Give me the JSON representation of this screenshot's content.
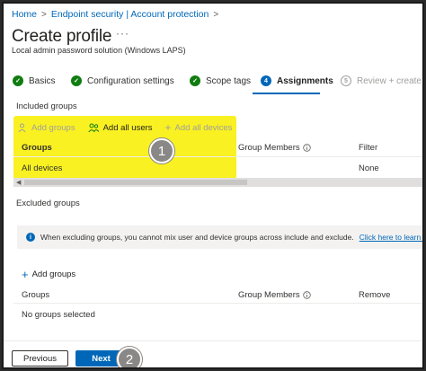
{
  "breadcrumb": {
    "items": [
      "Home",
      "Endpoint security | Account protection"
    ],
    "separator": ">"
  },
  "page": {
    "title": "Create profile",
    "more": "···",
    "subtitle": "Local admin password solution (Windows LAPS)"
  },
  "steps": [
    {
      "label": "Basics",
      "state": "done",
      "badge": "✓"
    },
    {
      "label": "Configuration settings",
      "state": "done",
      "badge": "✓"
    },
    {
      "label": "Scope tags",
      "state": "done",
      "badge": "✓"
    },
    {
      "label": "Assignments",
      "state": "current",
      "badge": "4"
    },
    {
      "label": "Review + create",
      "state": "future",
      "badge": "5"
    }
  ],
  "included": {
    "title": "Included groups",
    "commands": {
      "add_groups": "Add groups",
      "add_all_users": "Add all users",
      "add_all_devices": "Add all devices"
    },
    "columns": {
      "groups": "Groups",
      "members": "Group Members",
      "filter": "Filter"
    },
    "rows": [
      {
        "group": "All devices",
        "filter": "None"
      }
    ]
  },
  "excluded": {
    "title": "Excluded groups",
    "info": "When excluding groups, you cannot mix user and device groups across include and exclude.",
    "info_link": "Click here to learn more abo",
    "add_groups": "Add groups",
    "columns": {
      "groups": "Groups",
      "members": "Group Members",
      "remove": "Remove"
    },
    "empty": "No groups selected"
  },
  "footer": {
    "previous": "Previous",
    "next": "Next"
  },
  "callouts": {
    "one": "1",
    "two": "2"
  },
  "colors": {
    "accent": "#0067b8",
    "success": "#107c10",
    "highlight": "#f8f00f"
  }
}
